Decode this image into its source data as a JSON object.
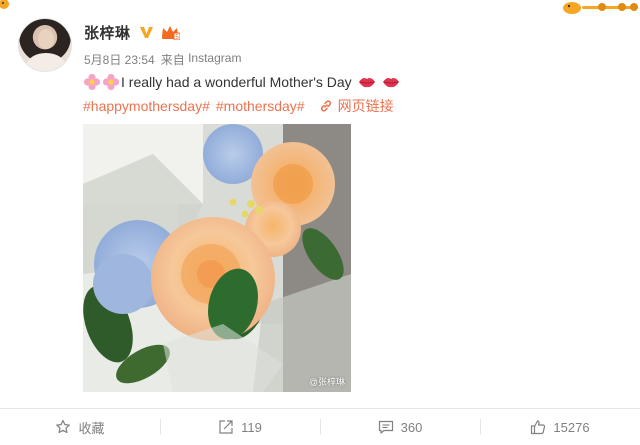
{
  "post": {
    "author_name": "张梓琳",
    "date": "5月8日 23:54",
    "source_prefix": "来自",
    "source_app": "Instagram",
    "text": "I really had a wonderful Mother's Day",
    "tags": [
      "#happymothersday#",
      "#mothersday#"
    ],
    "web_link_label": "网页链接",
    "photo_watermark": "@张梓琳"
  },
  "actions": {
    "favorite_label": "收藏",
    "repost_count": "119",
    "comment_count": "360",
    "like_count": "15276"
  },
  "icons": {
    "verified": "verified-v-icon",
    "member": "member-crown-icon",
    "flower": "flower-emoji-icon",
    "lips": "lips-emoji-icon",
    "link": "link-icon",
    "favorite": "star-icon",
    "repost": "share-icon",
    "comment": "comment-icon",
    "like": "thumbs-up-icon"
  },
  "colors": {
    "accent": "#eb7350",
    "verified": "#f5a623",
    "meta_text": "#808080",
    "body_text": "#333333"
  }
}
